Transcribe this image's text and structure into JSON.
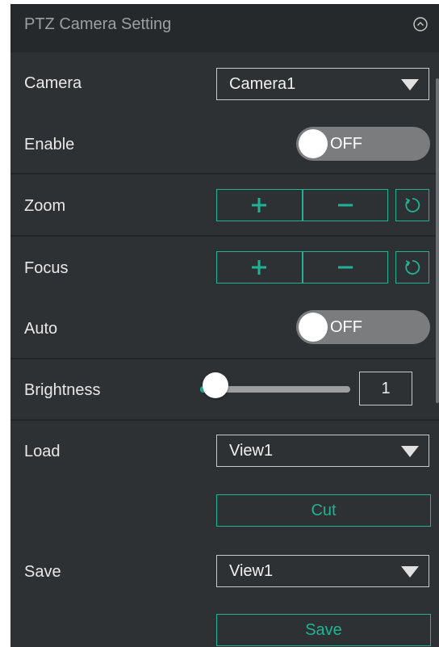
{
  "header": {
    "title": "PTZ Camera Setting",
    "collapse_icon": "chevron-up-circle-icon"
  },
  "camera": {
    "label": "Camera",
    "selected": "Camera1"
  },
  "enable": {
    "label": "Enable",
    "state": "OFF"
  },
  "zoom": {
    "label": "Zoom",
    "plus_icon": "plus-icon",
    "minus_icon": "minus-icon",
    "reset_icon": "reset-icon"
  },
  "focus": {
    "label": "Focus",
    "plus_icon": "plus-icon",
    "minus_icon": "minus-icon",
    "reset_icon": "reset-icon"
  },
  "auto": {
    "label": "Auto",
    "state": "OFF"
  },
  "brightness": {
    "label": "Brightness",
    "value": "1",
    "slider_fraction": 0.1
  },
  "load": {
    "label": "Load",
    "selected": "View1",
    "button_label": "Cut"
  },
  "save": {
    "label": "Save",
    "selected": "View1",
    "button_label": "Save"
  },
  "colors": {
    "accent": "#20b294",
    "panel": "#2e3133",
    "header": "#26292b"
  }
}
